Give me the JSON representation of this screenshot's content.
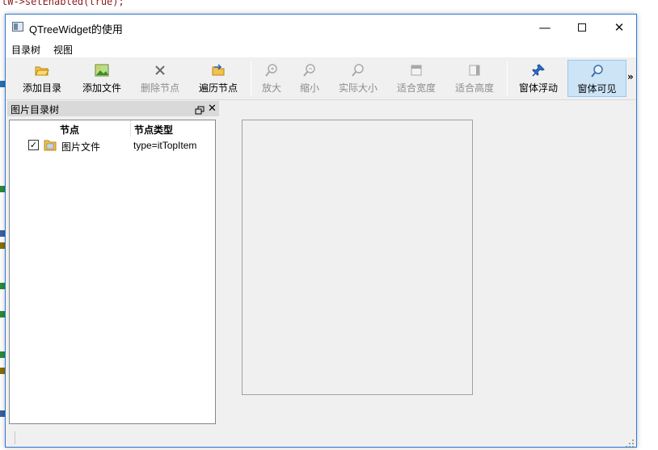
{
  "background": {
    "code_line": "tW->setEnabled(true);"
  },
  "window": {
    "title": "QTreeWidget的使用",
    "controls": {
      "minimize": "—",
      "close": "✕"
    }
  },
  "menubar": {
    "items": [
      "目录树",
      "视图"
    ]
  },
  "toolbar": {
    "buttons": [
      {
        "label": "添加目录",
        "icon": "folder-open-icon",
        "enabled": true
      },
      {
        "label": "添加文件",
        "icon": "image-file-icon",
        "enabled": true
      },
      {
        "label": "删除节点",
        "icon": "delete-x-icon",
        "enabled": false
      },
      {
        "label": "遍历节点",
        "icon": "traverse-icon",
        "enabled": true
      },
      {
        "label": "放大",
        "icon": "zoom-in-icon",
        "enabled": false
      },
      {
        "label": "缩小",
        "icon": "zoom-out-icon",
        "enabled": false
      },
      {
        "label": "实际大小",
        "icon": "actual-size-icon",
        "enabled": false
      },
      {
        "label": "适合宽度",
        "icon": "fit-width-icon",
        "enabled": false
      },
      {
        "label": "适合高度",
        "icon": "fit-height-icon",
        "enabled": false
      },
      {
        "label": "窗体浮动",
        "icon": "pin-icon",
        "enabled": true
      },
      {
        "label": "窗体可见",
        "icon": "magnifier-icon",
        "enabled": true,
        "active": true
      }
    ],
    "extension": "»"
  },
  "dock": {
    "title": "图片目录树",
    "close": "✕"
  },
  "tree": {
    "columns": [
      "节点",
      "节点类型"
    ],
    "rows": [
      {
        "checked": "✓",
        "name": "图片文件",
        "type": "type=itTopItem"
      }
    ]
  },
  "colors": {
    "window_border": "#2b79d6",
    "active_button_bg": "#cde4f7",
    "active_button_border": "#99c9ef",
    "dock_title_bg": "#d9d9d9"
  }
}
